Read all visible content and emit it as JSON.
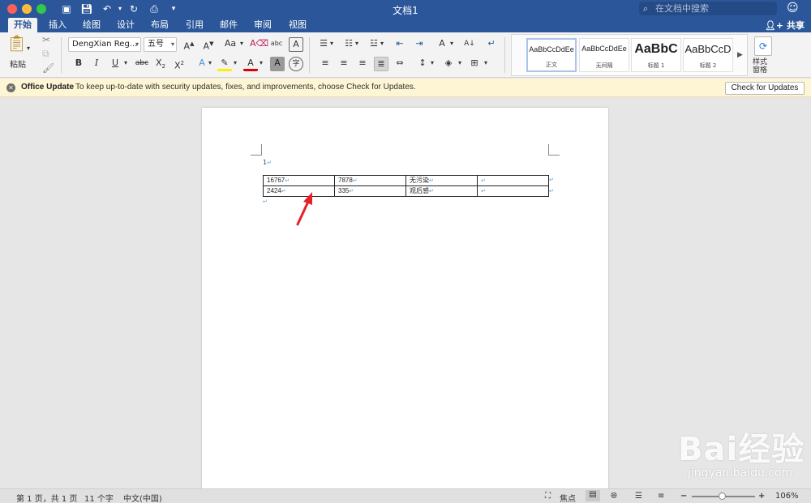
{
  "window": {
    "title": "文档1",
    "search_placeholder": "在文档中搜索"
  },
  "tabs": [
    {
      "label": "开始",
      "active": true
    },
    {
      "label": "插入"
    },
    {
      "label": "绘图"
    },
    {
      "label": "设计"
    },
    {
      "label": "布局"
    },
    {
      "label": "引用"
    },
    {
      "label": "邮件"
    },
    {
      "label": "审阅"
    },
    {
      "label": "视图"
    }
  ],
  "share_label": "共享",
  "ribbon": {
    "paste_label": "粘贴",
    "font_name": "DengXian Reg...",
    "font_size": "五号",
    "styles": [
      {
        "sample": "AaBbCcDdEe",
        "name": "正文"
      },
      {
        "sample": "AaBbCcDdEe",
        "name": "无间隔"
      },
      {
        "sample": "AaBbC",
        "name": "标题 1"
      },
      {
        "sample": "AaBbCcD",
        "name": "标题 2"
      }
    ],
    "styles_pane_label_1": "样式",
    "styles_pane_label_2": "窗格"
  },
  "message_bar": {
    "title": "Office Update",
    "text": "To keep up-to-date with security updates, fixes, and improvements, choose Check for Updates.",
    "button": "Check for Updates"
  },
  "document": {
    "paragraph_number": "1",
    "table": [
      [
        "16767",
        "7878",
        "无污染",
        ""
      ],
      [
        "2424",
        "335",
        "观后感",
        ""
      ]
    ]
  },
  "status": {
    "page": "第 1 页，共 1 页",
    "words": "11 个字",
    "language": "中文(中国)",
    "focus": "焦点",
    "zoom": "106%"
  },
  "watermark": {
    "brand": "Bai经验",
    "url": "jingyan.baidu.com"
  },
  "colors": {
    "accent": "#2b579a",
    "arrow": "#e8202a"
  }
}
